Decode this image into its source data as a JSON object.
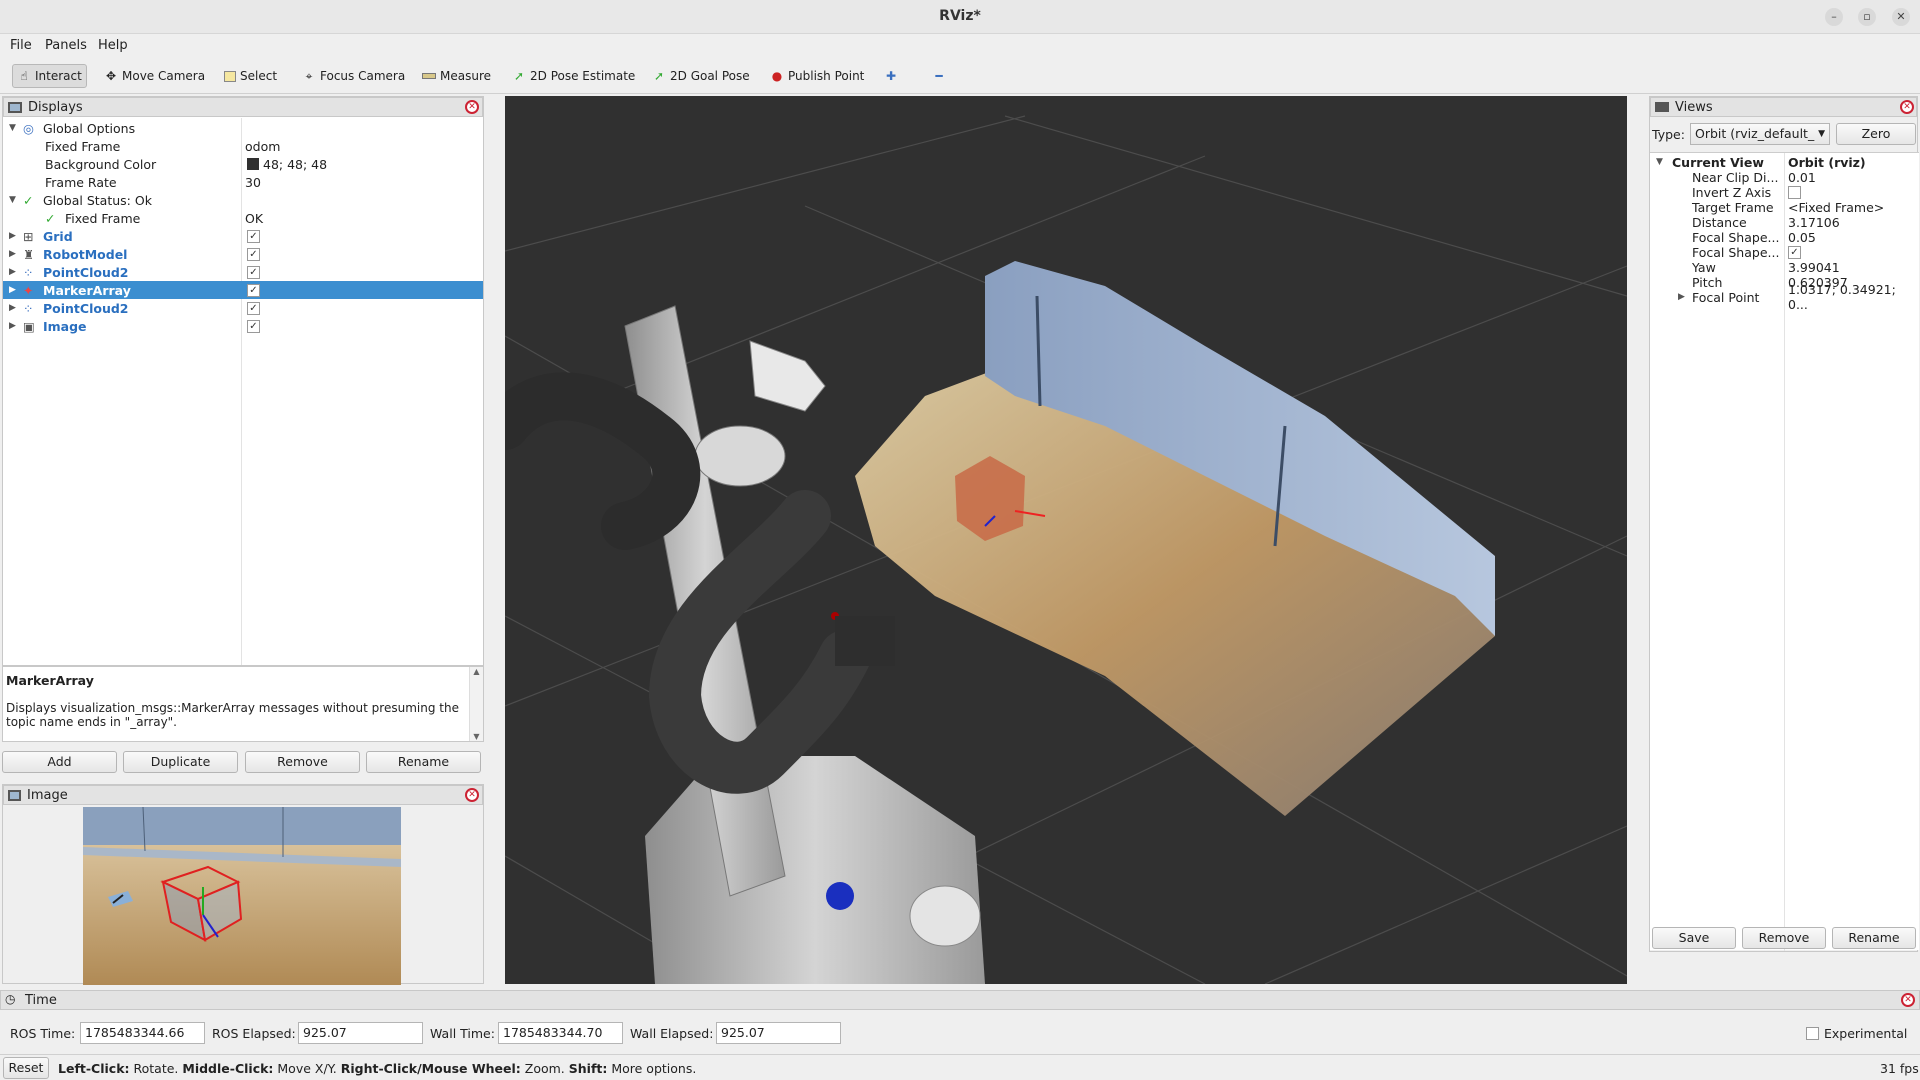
{
  "window": {
    "title": "RViz*"
  },
  "menu": [
    "File",
    "Panels",
    "Help"
  ],
  "toolbar": {
    "tools": [
      {
        "label": "Interact",
        "icon": "hand-icon"
      },
      {
        "label": "Move Camera",
        "icon": "move-icon"
      },
      {
        "label": "Select",
        "icon": "select-icon"
      },
      {
        "label": "Focus Camera",
        "icon": "focus-icon"
      },
      {
        "label": "Measure",
        "icon": "ruler-icon"
      },
      {
        "label": "2D Pose Estimate",
        "icon": "pose-estimate-icon"
      },
      {
        "label": "2D Goal Pose",
        "icon": "goal-pose-icon"
      },
      {
        "label": "Publish Point",
        "icon": "pin-icon"
      }
    ]
  },
  "displays": {
    "title": "Displays",
    "global_options": "Global Options",
    "fixed_frame_label": "Fixed Frame",
    "fixed_frame_value": "odom",
    "bg_color_label": "Background Color",
    "bg_color_value": "48; 48; 48",
    "frame_rate_label": "Frame Rate",
    "frame_rate_value": "30",
    "global_status": "Global Status: Ok",
    "status_fixed_frame": "Fixed Frame",
    "status_fixed_frame_value": "OK",
    "items": [
      "Grid",
      "RobotModel",
      "PointCloud2",
      "MarkerArray",
      "PointCloud2",
      "Image"
    ],
    "desc_title": "MarkerArray",
    "desc_text": "Displays visualization_msgs::MarkerArray messages without presuming the topic name ends in \"_array\".",
    "buttons": [
      "Add",
      "Duplicate",
      "Remove",
      "Rename"
    ]
  },
  "image_panel": {
    "title": "Image"
  },
  "views": {
    "title": "Views",
    "type_label": "Type:",
    "type_value": "Orbit (rviz_default_",
    "zero": "Zero",
    "current_view": "Current View",
    "current_view_value": "Orbit (rviz)",
    "props": [
      {
        "k": "Near Clip Di...",
        "v": "0.01"
      },
      {
        "k": "Invert Z Axis",
        "v": ""
      },
      {
        "k": "Target Frame",
        "v": "<Fixed Frame>"
      },
      {
        "k": "Distance",
        "v": "3.17106"
      },
      {
        "k": "Focal Shape...",
        "v": "0.05"
      },
      {
        "k": "Focal Shape...",
        "v": ""
      },
      {
        "k": "Yaw",
        "v": "3.99041"
      },
      {
        "k": "Pitch",
        "v": "0.620397"
      },
      {
        "k": "Focal Point",
        "v": "1.0317; 0.34921; 0..."
      }
    ],
    "buttons": [
      "Save",
      "Remove",
      "Rename"
    ]
  },
  "time": {
    "title": "Time",
    "ros_time_label": "ROS Time:",
    "ros_time": "1785483344.66",
    "ros_elapsed_label": "ROS Elapsed:",
    "ros_elapsed": "925.07",
    "wall_time_label": "Wall Time:",
    "wall_time": "1785483344.70",
    "wall_elapsed_label": "Wall Elapsed:",
    "wall_elapsed": "925.07",
    "experimental": "Experimental"
  },
  "status": {
    "reset": "Reset",
    "b1": "Left-Click:",
    "t1": " Rotate. ",
    "b2": "Middle-Click:",
    "t2": " Move X/Y. ",
    "b3": "Right-Click/Mouse Wheel:",
    "t3": " Zoom. ",
    "b4": "Shift:",
    "t4": " More options.",
    "fps": "31 fps"
  },
  "colors": {
    "selection": "#3b8ed0",
    "viewport_bg": "#303030"
  }
}
